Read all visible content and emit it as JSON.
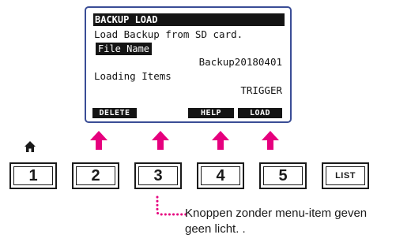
{
  "screen": {
    "title": "BACKUP LOAD",
    "line1": "Load Backup from SD card.",
    "file_name_label": "File Name",
    "file_name_value": "Backup20180401",
    "loading_items_label": "Loading Items",
    "loading_items_value": "TRIGGER"
  },
  "softkeys": [
    "DELETE",
    "HELP",
    "LOAD"
  ],
  "buttons": [
    "1",
    "2",
    "3",
    "4",
    "5",
    "LIST"
  ],
  "callout": {
    "line1": "Knoppen zonder menu-item geven",
    "line2": "geen licht. ."
  },
  "colors": {
    "accent": "#e6007e",
    "lcd_border": "#3a4d96",
    "lcd_ink": "#141414"
  },
  "icons": {
    "home": "home-icon",
    "arrow": "arrow-up-icon"
  }
}
